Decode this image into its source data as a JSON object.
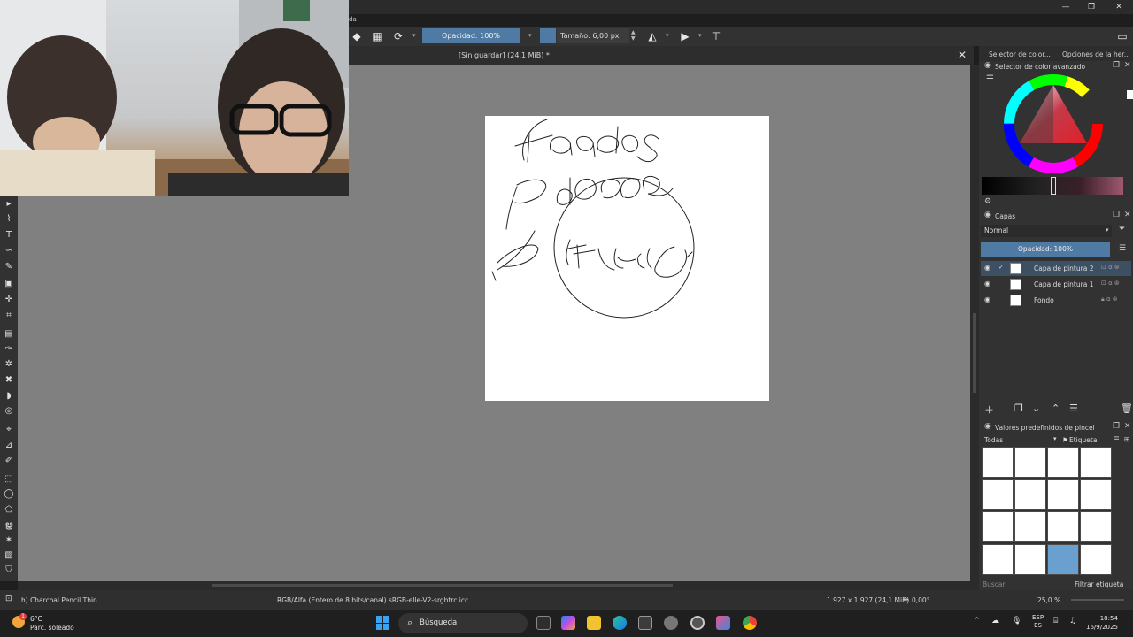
{
  "titlebar": {
    "menu_fragment": "da",
    "min": "—",
    "max": "❐",
    "close": "✕"
  },
  "toolbar": {
    "opacity_label": "Opacidad: 100%",
    "size_label": "Tamaño: 6,00 px"
  },
  "document": {
    "tab_title": "[Sin guardar]  (24,1 MiB) *",
    "close": "✕"
  },
  "dockers": {
    "tabs": [
      "Selector de color...",
      "Opciones de la her..."
    ],
    "color_selector_title": "Selector de color avanzado",
    "layers_title": "Capas",
    "blend_mode": "Normal",
    "layer_opacity": "Opacidad:  100%",
    "layers": [
      {
        "name": "Capa de pintura 2",
        "active": true
      },
      {
        "name": "Capa de pintura 1",
        "active": false
      },
      {
        "name": "Fondo",
        "active": false
      }
    ],
    "brush_presets_title": "Valores predefinidos de pincel",
    "brush_tag_filter": "Todas",
    "brush_tag_label": "Etiqueta",
    "brush_search_placeholder": "Buscar",
    "brush_filter_tag": "Filtrar etiqueta"
  },
  "status": {
    "brush_name": "h) Charcoal Pencil Thin",
    "color_profile": "RGB/Alfa (Entero de 8 bits/canal)  sRGB-elle-V2-srgbtrc.icc",
    "image_size": "1.927 x 1.927 (24,1 MiB)",
    "rotation": "0,00°",
    "zoom": "25,0 %"
  },
  "taskbar": {
    "weather_temp": "6°C",
    "weather_desc": "Parc. soleado",
    "weather_badge": "1",
    "search_label": "Búsqueda",
    "lang_top": "ESP",
    "lang_bottom": "ES",
    "time": "18:54",
    "date": "16/9/2025"
  },
  "colors": {
    "accent": "#4f7aa3",
    "canvas_bg": "#808080",
    "panel_bg": "#323232"
  }
}
